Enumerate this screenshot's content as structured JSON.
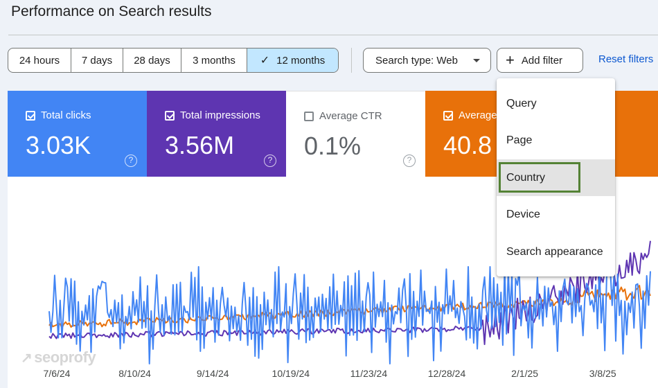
{
  "header": {
    "title": "Performance on Search results"
  },
  "toolbar": {
    "ranges": [
      {
        "label": "24 hours",
        "selected": false
      },
      {
        "label": "7 days",
        "selected": false
      },
      {
        "label": "28 days",
        "selected": false
      },
      {
        "label": "3 months",
        "selected": false
      },
      {
        "label": "12 months",
        "selected": true
      }
    ],
    "search_type": "Search type: Web",
    "add_filter": "Add filter",
    "reset": "Reset filters"
  },
  "metrics": {
    "clicks": {
      "label": "Total clicks",
      "value": "3.03K",
      "checked": true,
      "color": "#4285f4"
    },
    "impressions": {
      "label": "Total impressions",
      "value": "3.56M",
      "checked": true,
      "color": "#5e35b1"
    },
    "ctr": {
      "label": "Average CTR",
      "value": "0.1%",
      "checked": false
    },
    "position": {
      "label": "Average",
      "value": "40.8",
      "checked": true,
      "color": "#e8710a"
    },
    "help_glyph": "?"
  },
  "filter_menu": {
    "items": [
      "Query",
      "Page",
      "Country",
      "Device",
      "Search appearance"
    ],
    "highlighted": "Country",
    "highlight_color": "#548235"
  },
  "watermark": "seoprofy",
  "chart_data": {
    "type": "line",
    "x_ticks": [
      "7/6/24",
      "8/10/24",
      "9/14/24",
      "10/19/24",
      "11/23/24",
      "12/28/24",
      "2/1/25",
      "3/8/25"
    ],
    "series": [
      {
        "color": "#4285f4",
        "note": "clicks, highly volatile daily values"
      },
      {
        "color": "#5e35b1",
        "note": "impressions, flat then rising sharply from Feb 2025"
      },
      {
        "color": "#e8710a",
        "note": "average position, gently rising trend"
      }
    ]
  }
}
